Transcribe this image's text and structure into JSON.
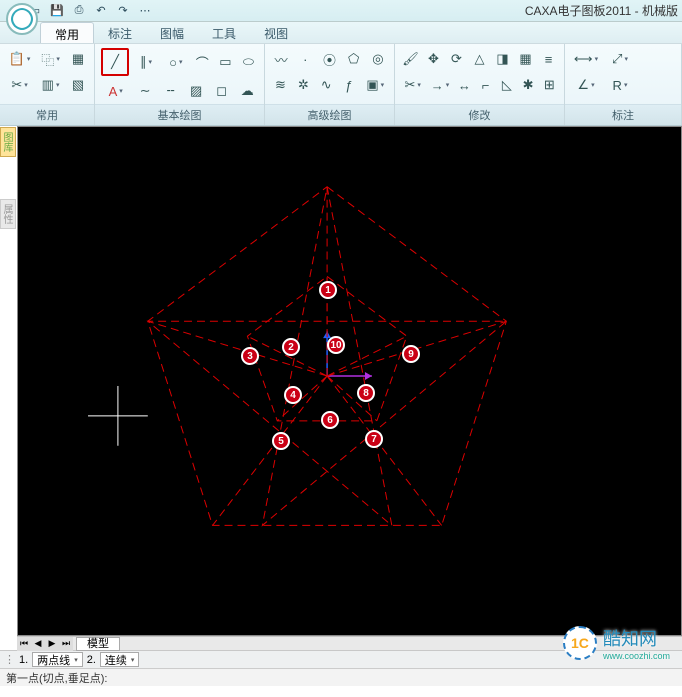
{
  "title": "CAXA电子图板2011 - 机械版",
  "tabs": {
    "t0": "常用",
    "t1": "标注",
    "t2": "图幅",
    "t3": "工具",
    "t4": "视图"
  },
  "groups": {
    "g0": "常用",
    "g1": "基本绘图",
    "g2": "高级绘图",
    "g3": "修改",
    "g4": "标注"
  },
  "model_tab": "模型",
  "prop": {
    "p1_label": "1.",
    "p1_value": "两点线",
    "p2_label": "2.",
    "p2_value": "连续"
  },
  "status": "第一点(切点,垂足点):",
  "markers": {
    "m1": "1",
    "m2": "2",
    "m3": "3",
    "m4": "4",
    "m5": "5",
    "m6": "6",
    "m7": "7",
    "m8": "8",
    "m9": "9",
    "m10": "10"
  },
  "watermark": {
    "logo": "1C",
    "name": "酷知网",
    "url": "www.coozhi.com"
  }
}
